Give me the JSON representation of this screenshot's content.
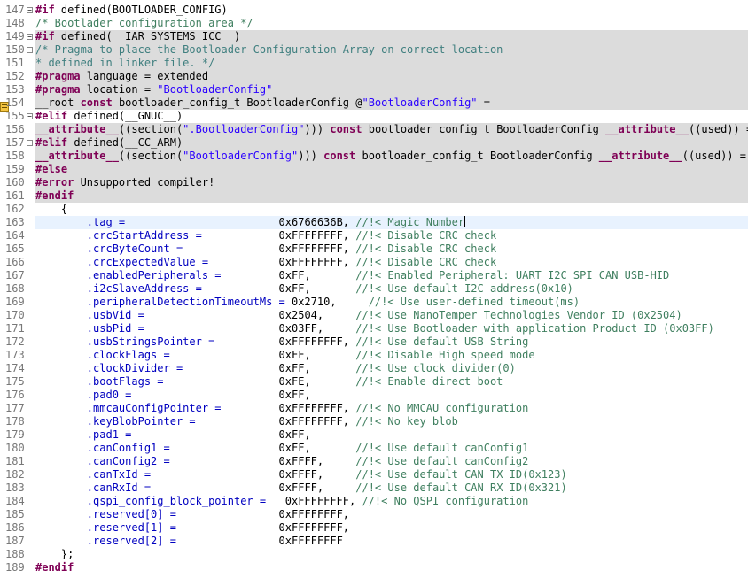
{
  "editor": {
    "lines": [
      {
        "n": "147",
        "fold": "minus",
        "bg": "",
        "parts": [
          {
            "t": "#if ",
            "c": "pp"
          },
          {
            "t": "defined(BOOTLOADER_CONFIG)",
            "c": ""
          }
        ]
      },
      {
        "n": "148",
        "fold": "",
        "bg": "",
        "parts": [
          {
            "t": "/* Bootlader configuration area */",
            "c": "cm"
          }
        ]
      },
      {
        "n": "149",
        "fold": "minus",
        "bg": "gray",
        "parts": [
          {
            "t": "#if ",
            "c": "pp"
          },
          {
            "t": "defined(__IAR_SYSTEMS_ICC__)",
            "c": ""
          }
        ]
      },
      {
        "n": "150",
        "fold": "minus",
        "bg": "gray",
        "parts": [
          {
            "t": "/* Pragma to place the Bootloader Configuration Array on correct location",
            "c": "cm ignored"
          }
        ]
      },
      {
        "n": "151",
        "fold": "",
        "bg": "gray",
        "parts": [
          {
            "t": "* defined in linker file. */",
            "c": "cm ignored"
          }
        ]
      },
      {
        "n": "152",
        "fold": "",
        "bg": "gray",
        "parts": [
          {
            "t": "#pragma ",
            "c": "pp"
          },
          {
            "t": "language = extended",
            "c": ""
          }
        ]
      },
      {
        "n": "153",
        "fold": "",
        "bg": "gray",
        "parts": [
          {
            "t": "#pragma ",
            "c": "pp"
          },
          {
            "t": "location = ",
            "c": ""
          },
          {
            "t": "\"BootloaderConfig\"",
            "c": "str"
          }
        ]
      },
      {
        "n": "154",
        "fold": "",
        "bg": "gray",
        "marker": true,
        "parts": [
          {
            "t": "__root ",
            "c": ""
          },
          {
            "t": "const ",
            "c": "kw"
          },
          {
            "t": "bootloader_config_t BootloaderConfig @",
            "c": ""
          },
          {
            "t": "\"BootloaderConfig\"",
            "c": "str"
          },
          {
            "t": " =",
            "c": ""
          }
        ]
      },
      {
        "n": "155",
        "fold": "minus",
        "bg": "",
        "parts": [
          {
            "t": "#elif ",
            "c": "pp"
          },
          {
            "t": "defined(__GNUC__)",
            "c": ""
          }
        ]
      },
      {
        "n": "156",
        "fold": "",
        "bg": "gray",
        "parts": [
          {
            "t": "__attribute__",
            "c": "kw"
          },
          {
            "t": "((section(",
            "c": ""
          },
          {
            "t": "\".BootloaderConfig\"",
            "c": "str"
          },
          {
            "t": "))) ",
            "c": ""
          },
          {
            "t": "const ",
            "c": "kw"
          },
          {
            "t": "bootloader_config_t BootloaderConfig ",
            "c": ""
          },
          {
            "t": "__attribute__",
            "c": "kw"
          },
          {
            "t": "((used)) =",
            "c": ""
          }
        ]
      },
      {
        "n": "157",
        "fold": "minus",
        "bg": "gray",
        "parts": [
          {
            "t": "#elif ",
            "c": "pp"
          },
          {
            "t": "defined(__CC_ARM)",
            "c": ""
          }
        ]
      },
      {
        "n": "158",
        "fold": "",
        "bg": "gray",
        "parts": [
          {
            "t": "__attribute__",
            "c": "kw"
          },
          {
            "t": "((section(",
            "c": ""
          },
          {
            "t": "\"BootloaderConfig\"",
            "c": "str"
          },
          {
            "t": "))) ",
            "c": ""
          },
          {
            "t": "const ",
            "c": "kw"
          },
          {
            "t": "bootloader_config_t BootloaderConfig ",
            "c": ""
          },
          {
            "t": "__attribute__",
            "c": "kw"
          },
          {
            "t": "((used)) =",
            "c": ""
          }
        ]
      },
      {
        "n": "159",
        "fold": "",
        "bg": "gray",
        "parts": [
          {
            "t": "#else",
            "c": "pp"
          }
        ]
      },
      {
        "n": "160",
        "fold": "",
        "bg": "gray",
        "parts": [
          {
            "t": "#error ",
            "c": "pp"
          },
          {
            "t": "Unsupported compiler!",
            "c": ""
          }
        ]
      },
      {
        "n": "161",
        "fold": "",
        "bg": "gray",
        "parts": [
          {
            "t": "#endif",
            "c": "pp"
          }
        ]
      },
      {
        "n": "162",
        "fold": "",
        "bg": "",
        "parts": [
          {
            "t": "    {",
            "c": ""
          }
        ]
      },
      {
        "n": "163",
        "fold": "",
        "bg": "cur",
        "cursor": true,
        "parts": [
          {
            "t": "        .tag = ",
            "c": "fld"
          },
          {
            "t": "                       0x6766636B, ",
            "c": ""
          },
          {
            "t": "//!< Magic Number",
            "c": "cm"
          }
        ]
      },
      {
        "n": "164",
        "fold": "",
        "bg": "",
        "parts": [
          {
            "t": "        .crcStartAddress = ",
            "c": "fld"
          },
          {
            "t": "           0xFFFFFFFF, ",
            "c": ""
          },
          {
            "t": "//!< Disable CRC check",
            "c": "cm"
          }
        ]
      },
      {
        "n": "165",
        "fold": "",
        "bg": "",
        "parts": [
          {
            "t": "        .crcByteCount = ",
            "c": "fld"
          },
          {
            "t": "              0xFFFFFFFF, ",
            "c": ""
          },
          {
            "t": "//!< Disable CRC check",
            "c": "cm"
          }
        ]
      },
      {
        "n": "166",
        "fold": "",
        "bg": "",
        "parts": [
          {
            "t": "        .crcExpectedValue = ",
            "c": "fld"
          },
          {
            "t": "          0xFFFFFFFF, ",
            "c": ""
          },
          {
            "t": "//!< Disable CRC check",
            "c": "cm"
          }
        ]
      },
      {
        "n": "167",
        "fold": "",
        "bg": "",
        "parts": [
          {
            "t": "        .enabledPeripherals = ",
            "c": "fld"
          },
          {
            "t": "        0xFF,       ",
            "c": ""
          },
          {
            "t": "//!< Enabled Peripheral: UART I2C SPI CAN USB-HID",
            "c": "cm"
          }
        ]
      },
      {
        "n": "168",
        "fold": "",
        "bg": "",
        "parts": [
          {
            "t": "        .i2cSlaveAddress = ",
            "c": "fld"
          },
          {
            "t": "           0xFF,       ",
            "c": ""
          },
          {
            "t": "//!< Use default I2C address(0x10)",
            "c": "cm"
          }
        ]
      },
      {
        "n": "169",
        "fold": "",
        "bg": "",
        "parts": [
          {
            "t": "        .peripheralDetectionTimeoutMs = ",
            "c": "fld"
          },
          {
            "t": "0x2710,     ",
            "c": ""
          },
          {
            "t": "//!< Use user-defined timeout(ms)",
            "c": "cm"
          }
        ]
      },
      {
        "n": "170",
        "fold": "",
        "bg": "",
        "parts": [
          {
            "t": "        .usbVid = ",
            "c": "fld"
          },
          {
            "t": "                    0x2504,     ",
            "c": ""
          },
          {
            "t": "//!< Use NanoTemper Technologies Vendor ID (0x2504)",
            "c": "cm"
          }
        ]
      },
      {
        "n": "171",
        "fold": "",
        "bg": "",
        "parts": [
          {
            "t": "        .usbPid = ",
            "c": "fld"
          },
          {
            "t": "                    0x03FF,     ",
            "c": ""
          },
          {
            "t": "//!< Use Bootloader with application Product ID (0x03FF)",
            "c": "cm"
          }
        ]
      },
      {
        "n": "172",
        "fold": "",
        "bg": "",
        "parts": [
          {
            "t": "        .usbStringsPointer = ",
            "c": "fld"
          },
          {
            "t": "         0xFFFFFFFF, ",
            "c": ""
          },
          {
            "t": "//!< Use default USB String",
            "c": "cm"
          }
        ]
      },
      {
        "n": "173",
        "fold": "",
        "bg": "",
        "parts": [
          {
            "t": "        .clockFlags = ",
            "c": "fld"
          },
          {
            "t": "                0xFF,       ",
            "c": ""
          },
          {
            "t": "//!< Disable High speed mode",
            "c": "cm"
          }
        ]
      },
      {
        "n": "174",
        "fold": "",
        "bg": "",
        "parts": [
          {
            "t": "        .clockDivider = ",
            "c": "fld"
          },
          {
            "t": "              0xFF,       ",
            "c": ""
          },
          {
            "t": "//!< Use clock divider(0)",
            "c": "cm"
          }
        ]
      },
      {
        "n": "175",
        "fold": "",
        "bg": "",
        "parts": [
          {
            "t": "        .bootFlags = ",
            "c": "fld"
          },
          {
            "t": "                 0xFE,       ",
            "c": ""
          },
          {
            "t": "//!< Enable direct boot",
            "c": "cm"
          }
        ]
      },
      {
        "n": "176",
        "fold": "",
        "bg": "",
        "parts": [
          {
            "t": "        .pad0 = ",
            "c": "fld"
          },
          {
            "t": "                      0xFF,",
            "c": ""
          }
        ]
      },
      {
        "n": "177",
        "fold": "",
        "bg": "",
        "parts": [
          {
            "t": "        .mmcauConfigPointer = ",
            "c": "fld"
          },
          {
            "t": "        0xFFFFFFFF, ",
            "c": ""
          },
          {
            "t": "//!< No MMCAU configuration",
            "c": "cm"
          }
        ]
      },
      {
        "n": "178",
        "fold": "",
        "bg": "",
        "parts": [
          {
            "t": "        .keyBlobPointer = ",
            "c": "fld"
          },
          {
            "t": "            0xFFFFFFFF, ",
            "c": ""
          },
          {
            "t": "//!< No key blob",
            "c": "cm"
          }
        ]
      },
      {
        "n": "179",
        "fold": "",
        "bg": "",
        "parts": [
          {
            "t": "        .pad1 = ",
            "c": "fld"
          },
          {
            "t": "                      0xFF,",
            "c": ""
          }
        ]
      },
      {
        "n": "180",
        "fold": "",
        "bg": "",
        "parts": [
          {
            "t": "        .canConfig1 = ",
            "c": "fld"
          },
          {
            "t": "                0xFF,       ",
            "c": ""
          },
          {
            "t": "//!< Use default canConfig1",
            "c": "cm"
          }
        ]
      },
      {
        "n": "181",
        "fold": "",
        "bg": "",
        "parts": [
          {
            "t": "        .canConfig2 = ",
            "c": "fld"
          },
          {
            "t": "                0xFFFF,     ",
            "c": ""
          },
          {
            "t": "//!< Use default canConfig2",
            "c": "cm"
          }
        ]
      },
      {
        "n": "182",
        "fold": "",
        "bg": "",
        "parts": [
          {
            "t": "        .canTxId = ",
            "c": "fld"
          },
          {
            "t": "                   0xFFFF,     ",
            "c": ""
          },
          {
            "t": "//!< Use default CAN TX ID(0x123)",
            "c": "cm"
          }
        ]
      },
      {
        "n": "183",
        "fold": "",
        "bg": "",
        "parts": [
          {
            "t": "        .canRxId = ",
            "c": "fld"
          },
          {
            "t": "                   0xFFFF,     ",
            "c": ""
          },
          {
            "t": "//!< Use default CAN RX ID(0x321)",
            "c": "cm"
          }
        ]
      },
      {
        "n": "184",
        "fold": "",
        "bg": "",
        "parts": [
          {
            "t": "        .qspi_config_block_pointer = ",
            "c": "fld"
          },
          {
            "t": "  0xFFFFFFFF, ",
            "c": ""
          },
          {
            "t": "//!< No QSPI configuration",
            "c": "cm"
          }
        ]
      },
      {
        "n": "185",
        "fold": "",
        "bg": "",
        "parts": [
          {
            "t": "        .reserved[0] = ",
            "c": "fld"
          },
          {
            "t": "               0xFFFFFFFF,",
            "c": ""
          }
        ]
      },
      {
        "n": "186",
        "fold": "",
        "bg": "",
        "parts": [
          {
            "t": "        .reserved[1] = ",
            "c": "fld"
          },
          {
            "t": "               0xFFFFFFFF,",
            "c": ""
          }
        ]
      },
      {
        "n": "187",
        "fold": "",
        "bg": "",
        "parts": [
          {
            "t": "        .reserved[2] = ",
            "c": "fld"
          },
          {
            "t": "               0xFFFFFFFF",
            "c": ""
          }
        ]
      },
      {
        "n": "188",
        "fold": "",
        "bg": "",
        "parts": [
          {
            "t": "    };",
            "c": ""
          }
        ]
      },
      {
        "n": "189",
        "fold": "",
        "bg": "",
        "parts": [
          {
            "t": "#endif",
            "c": "pp"
          }
        ]
      }
    ]
  },
  "colors": {
    "preprocessor": "#7f0055",
    "comment": "#3f7f5f",
    "string": "#2a00ff",
    "field": "#0000c0",
    "inactive_block": "#dcdcdc",
    "current_line": "#e8f2fe"
  },
  "icons": {
    "fold": "minus-fold-icon",
    "marker": "warning-marker-icon"
  }
}
